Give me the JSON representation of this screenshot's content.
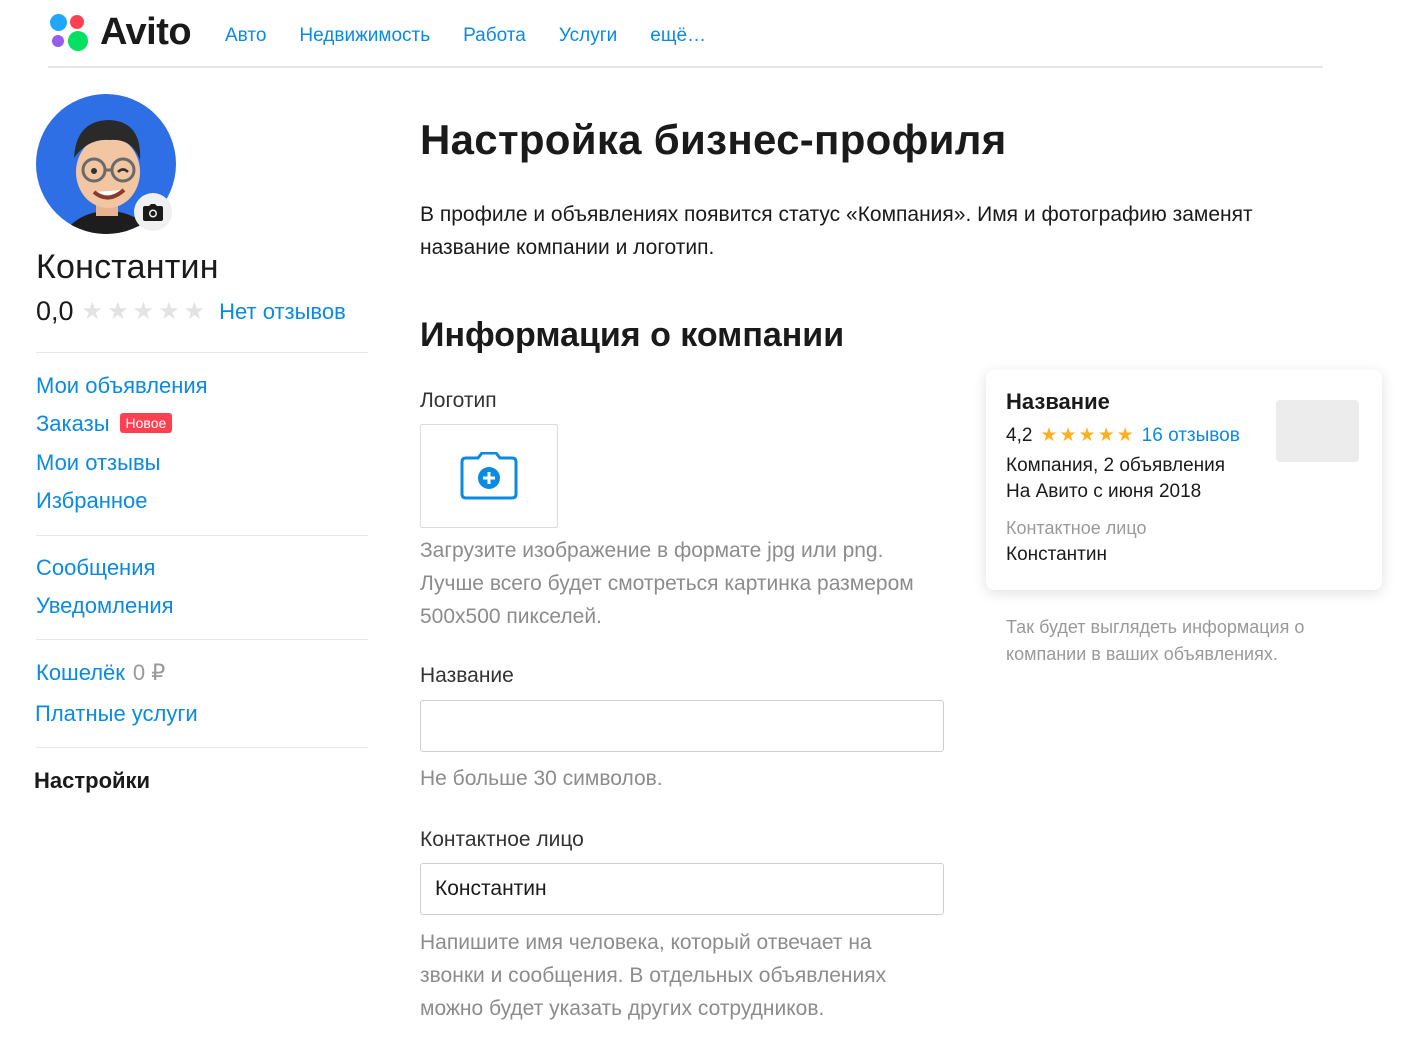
{
  "header": {
    "logo_text": "Avito",
    "nav": [
      "Авто",
      "Недвижимость",
      "Работа",
      "Услуги",
      "ещё…"
    ]
  },
  "profile": {
    "name": "Константин",
    "rating": "0,0",
    "reviews_link": "Нет отзывов"
  },
  "sidebar": {
    "my_ads": "Мои объявления",
    "orders": "Заказы",
    "orders_badge": "Новое",
    "my_reviews": "Мои отзывы",
    "favorites": "Избранное",
    "messages": "Сообщения",
    "notifications": "Уведомления",
    "wallet": "Кошелёк",
    "wallet_value": "0 ₽",
    "paid_services": "Платные услуги",
    "settings": "Настройки"
  },
  "main": {
    "title": "Настройка бизнес-профиля",
    "intro": "В профиле и объявлениях появится статус «Компания». Имя и фотографию заменят название компании и логотип.",
    "section_title": "Информация о компании",
    "logo_label": "Логотип",
    "logo_hint": "Загрузите изображение в формате jpg или png. Лучше всего будет смотреться картинка размером 500x500 пикселей.",
    "name_label": "Название",
    "name_value": "",
    "name_hint": "Не больше 30 символов.",
    "contact_label": "Контактное лицо",
    "contact_value": "Константин",
    "contact_hint": "Напишите имя человека, который отвечает на звонки и сообщения. В отдельных объявлениях можно будет указать других сотрудников."
  },
  "preview": {
    "title": "Название",
    "rating": "4,2",
    "reviews": "16 отзывов",
    "line1": "Компания, 2 объявления",
    "line2": "На Авито с июня 2018",
    "contact_label": "Контактное лицо",
    "contact_name": "Константин",
    "note": "Так будет выглядеть информация о компании в ваших объявлениях."
  },
  "colors": {
    "link": "#0a8ae0",
    "badge": "#ff4053",
    "star_gold": "#ffb021",
    "avatar_bg": "#2e6fe6"
  }
}
